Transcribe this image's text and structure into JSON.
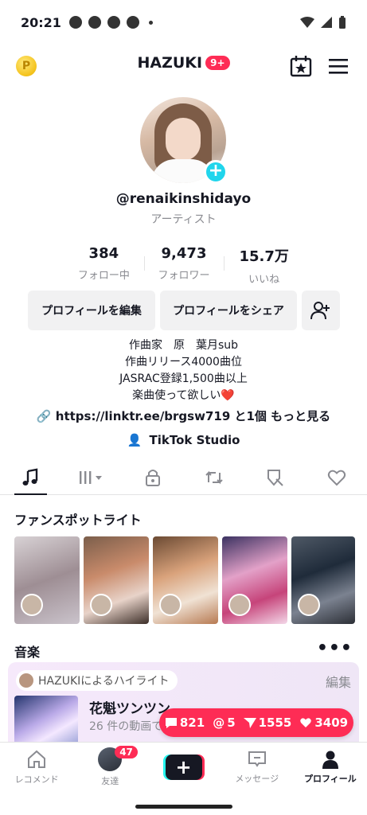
{
  "statusbar": {
    "time": "20:21"
  },
  "topbar": {
    "coin_label": "P",
    "account_name": "HAZUKI",
    "notification_badge": "9+"
  },
  "profile": {
    "username": "@renaikinshidayo",
    "role": "アーティスト",
    "stats": [
      {
        "value": "384",
        "label": "フォロー中"
      },
      {
        "value": "9,473",
        "label": "フォロワー"
      },
      {
        "value": "15.7万",
        "label": "いいね"
      }
    ],
    "edit_button": "プロフィールを編集",
    "share_button": "プロフィールをシェア",
    "bio_lines": [
      "作曲家　原　葉月sub",
      "作曲リリース4000曲位",
      "JASRAC登録1,500曲以上",
      "楽曲使って欲しい❤️"
    ],
    "link_text": "https://linktr.ee/brgsw719",
    "link_suffix": " と1個 もっと見る",
    "studio_label": "TikTok Studio"
  },
  "tabs": [
    "music-icon",
    "bars-icon",
    "lock-icon",
    "repost-icon",
    "tag-icon",
    "heart-icon"
  ],
  "fan_spotlight": {
    "title": "ファンスポットライト"
  },
  "music": {
    "title": "音楽",
    "more": "•••",
    "highlight_chip": "HAZUKIによるハイライト",
    "edit": "編集",
    "song": "花魁ツンツン",
    "sub": "26 件の動画で"
  },
  "floating": {
    "comments": "821",
    "mentions": "5",
    "shares": "1555",
    "likes": "3409"
  },
  "bottomnav": {
    "home": "レコメンド",
    "friends": "友達",
    "friends_count": "47",
    "messages": "メッセージ",
    "profile": "プロフィール"
  },
  "colors": {
    "accent": "#fe2c55",
    "cyan": "#20d5ec"
  }
}
